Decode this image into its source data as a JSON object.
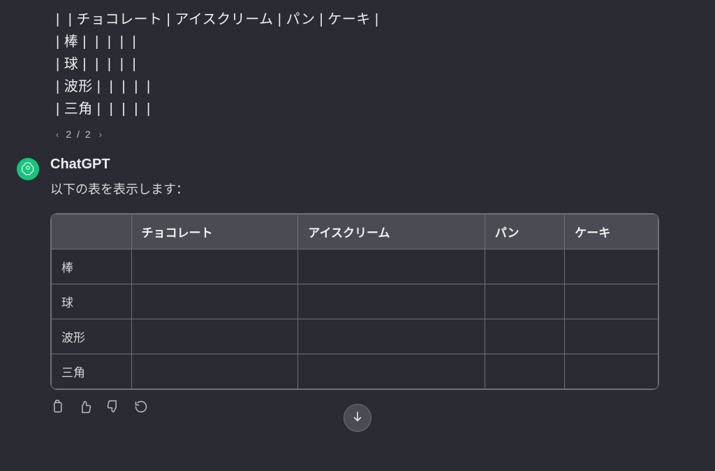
{
  "user": {
    "raw_lines": [
      "|  | チョコレート | アイスクリーム | パン | ケーキ |",
      "| 棒 |  |  |  |  |",
      "| 球 |  |  |  |  |",
      "| 波形 |  |  |  |  |",
      "| 三角 |  |  |  |  |"
    ],
    "pager": {
      "current": "2",
      "sep": "/",
      "total": "2"
    }
  },
  "assistant": {
    "name": "ChatGPT",
    "intro": "以下の表を表示します：",
    "table": {
      "headers": [
        "",
        "チョコレート",
        "アイスクリーム",
        "パン",
        "ケーキ"
      ],
      "rows": [
        [
          "棒",
          "",
          "",
          "",
          ""
        ],
        [
          "球",
          "",
          "",
          "",
          ""
        ],
        [
          "波形",
          "",
          "",
          "",
          ""
        ],
        [
          "三角",
          "",
          "",
          "",
          ""
        ]
      ]
    }
  }
}
